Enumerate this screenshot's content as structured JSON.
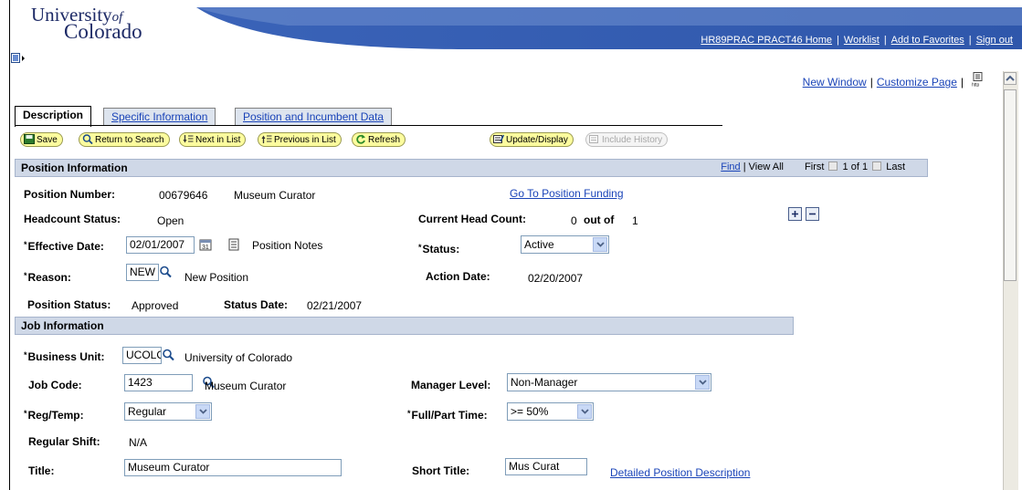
{
  "header": {
    "logo_univ": "University",
    "logo_of": "of",
    "logo_colo": "Colorado",
    "links": [
      "HR89PRAC PRACT46 Home",
      "Worklist",
      "Add to Favorites",
      "Sign out"
    ]
  },
  "page_links": {
    "new_window": "New Window",
    "customize": "Customize Page"
  },
  "tabs": [
    {
      "label": "Description",
      "active": true
    },
    {
      "label": "Specific Information",
      "active": false
    },
    {
      "label": "Position and Incumbent Data",
      "active": false
    }
  ],
  "toolbar": {
    "save": "Save",
    "return_to_search": "Return to Search",
    "next_in_list": "Next in List",
    "previous_in_list": "Previous in List",
    "refresh": "Refresh",
    "update_display": "Update/Display",
    "include_history": "Include History"
  },
  "position_info": {
    "title": "Position Information",
    "find": "Find",
    "view_all": "View All",
    "first": "First",
    "count": "1 of 1",
    "last": "Last",
    "position_number_label": "Position Number:",
    "position_number": "00679646",
    "position_desc": "Museum Curator",
    "go_to_funding": "Go To Position Funding",
    "headcount_status_label": "Headcount Status:",
    "headcount_status": "Open",
    "current_head_count_label": "Current Head Count:",
    "head_count_value": "0",
    "out_of": "out of",
    "head_count_max": "1",
    "effective_date_label": "Effective Date:",
    "effective_date": "02/01/2007",
    "position_notes": "Position Notes",
    "status_label": "Status:",
    "status": "Active",
    "reason_label": "Reason:",
    "reason": "NEW",
    "reason_desc": "New Position",
    "action_date_label": "Action Date:",
    "action_date": "02/20/2007",
    "position_status_label": "Position Status:",
    "position_status": "Approved",
    "status_date_label": "Status Date:",
    "status_date": "02/21/2007"
  },
  "job_info": {
    "title": "Job Information",
    "business_unit_label": "Business Unit:",
    "business_unit": "UCOLO",
    "business_unit_desc": "University of Colorado",
    "job_code_label": "Job Code:",
    "job_code": "1423",
    "job_code_desc": "Museum Curator",
    "manager_level_label": "Manager Level:",
    "manager_level": "Non-Manager",
    "reg_temp_label": "Reg/Temp:",
    "reg_temp": "Regular",
    "full_part_label": "Full/Part Time:",
    "full_part": ">= 50%",
    "regular_shift_label": "Regular Shift:",
    "regular_shift": "N/A",
    "title_label": "Title:",
    "title_value": "Museum Curator",
    "short_title_label": "Short Title:",
    "short_title": "Mus Curat",
    "detailed_desc": "Detailed Position Description"
  },
  "required_marker": "*"
}
